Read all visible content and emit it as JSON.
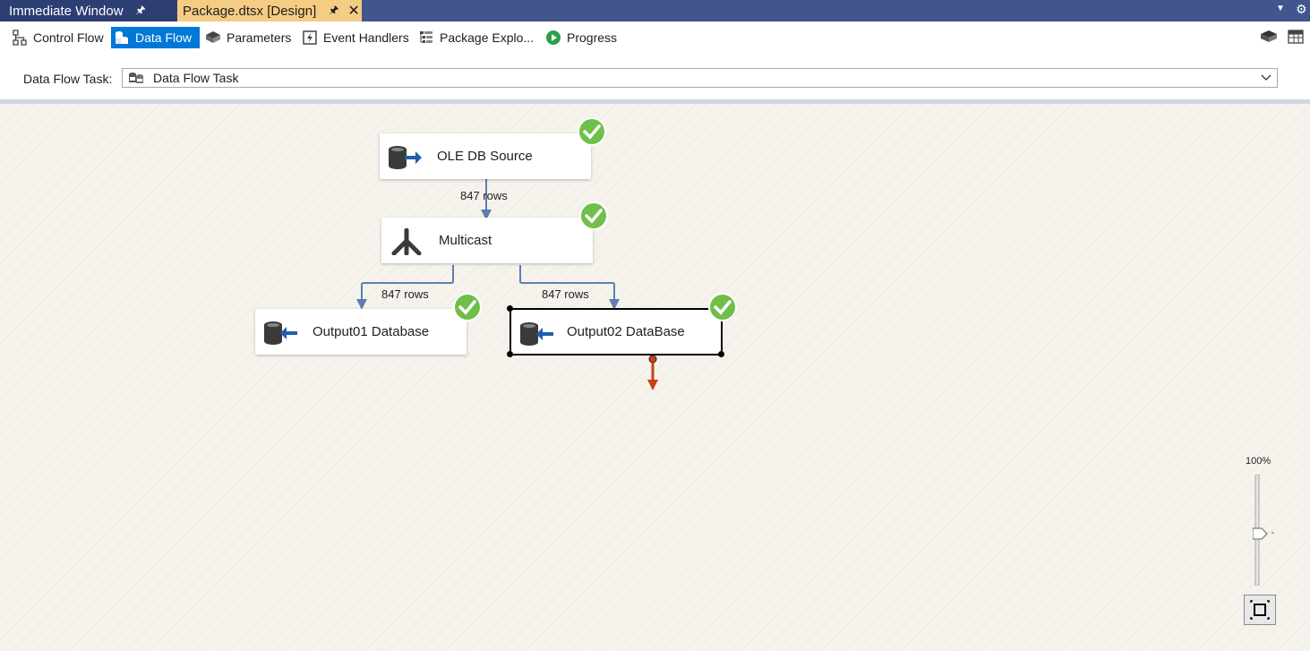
{
  "doc_tabs": {
    "immediate": {
      "label": "Immediate Window"
    },
    "package": {
      "label": "Package.dtsx [Design]"
    }
  },
  "designer_tabs": [
    {
      "label": "Control Flow",
      "icon": "control-flow-icon"
    },
    {
      "label": "Data Flow",
      "icon": "data-flow-icon",
      "active": true
    },
    {
      "label": "Parameters",
      "icon": "parameters-icon"
    },
    {
      "label": "Event Handlers",
      "icon": "event-handlers-icon"
    },
    {
      "label": "Package Explo...",
      "icon": "package-explorer-icon"
    },
    {
      "label": "Progress",
      "icon": "progress-icon"
    }
  ],
  "task_selector": {
    "label": "Data Flow Task:",
    "value": "Data Flow Task"
  },
  "components": [
    {
      "name": "OLE DB Source",
      "status": "success"
    },
    {
      "name": "Multicast",
      "status": "success"
    },
    {
      "name": "Output01 Database",
      "status": "success"
    },
    {
      "name": "Output02 DataBase",
      "status": "success",
      "selected": true
    }
  ],
  "paths": [
    {
      "from": "OLE DB Source",
      "to": "Multicast",
      "rows_label": "847 rows"
    },
    {
      "from": "Multicast",
      "to": "Output01 Database",
      "rows_label": "847 rows"
    },
    {
      "from": "Multicast",
      "to": "Output02 DataBase",
      "rows_label": "847 rows"
    }
  ],
  "zoom": {
    "label": "100%",
    "value_percent": 100
  },
  "colors": {
    "tab_strip": "#40568d",
    "active_doc_tab": "#f5cc84",
    "active_designer_tab": "#0078d7",
    "path_arrow": "#5b7fb0",
    "error_output_arrow": "#c8401a",
    "success_check": "#5cb85c"
  }
}
